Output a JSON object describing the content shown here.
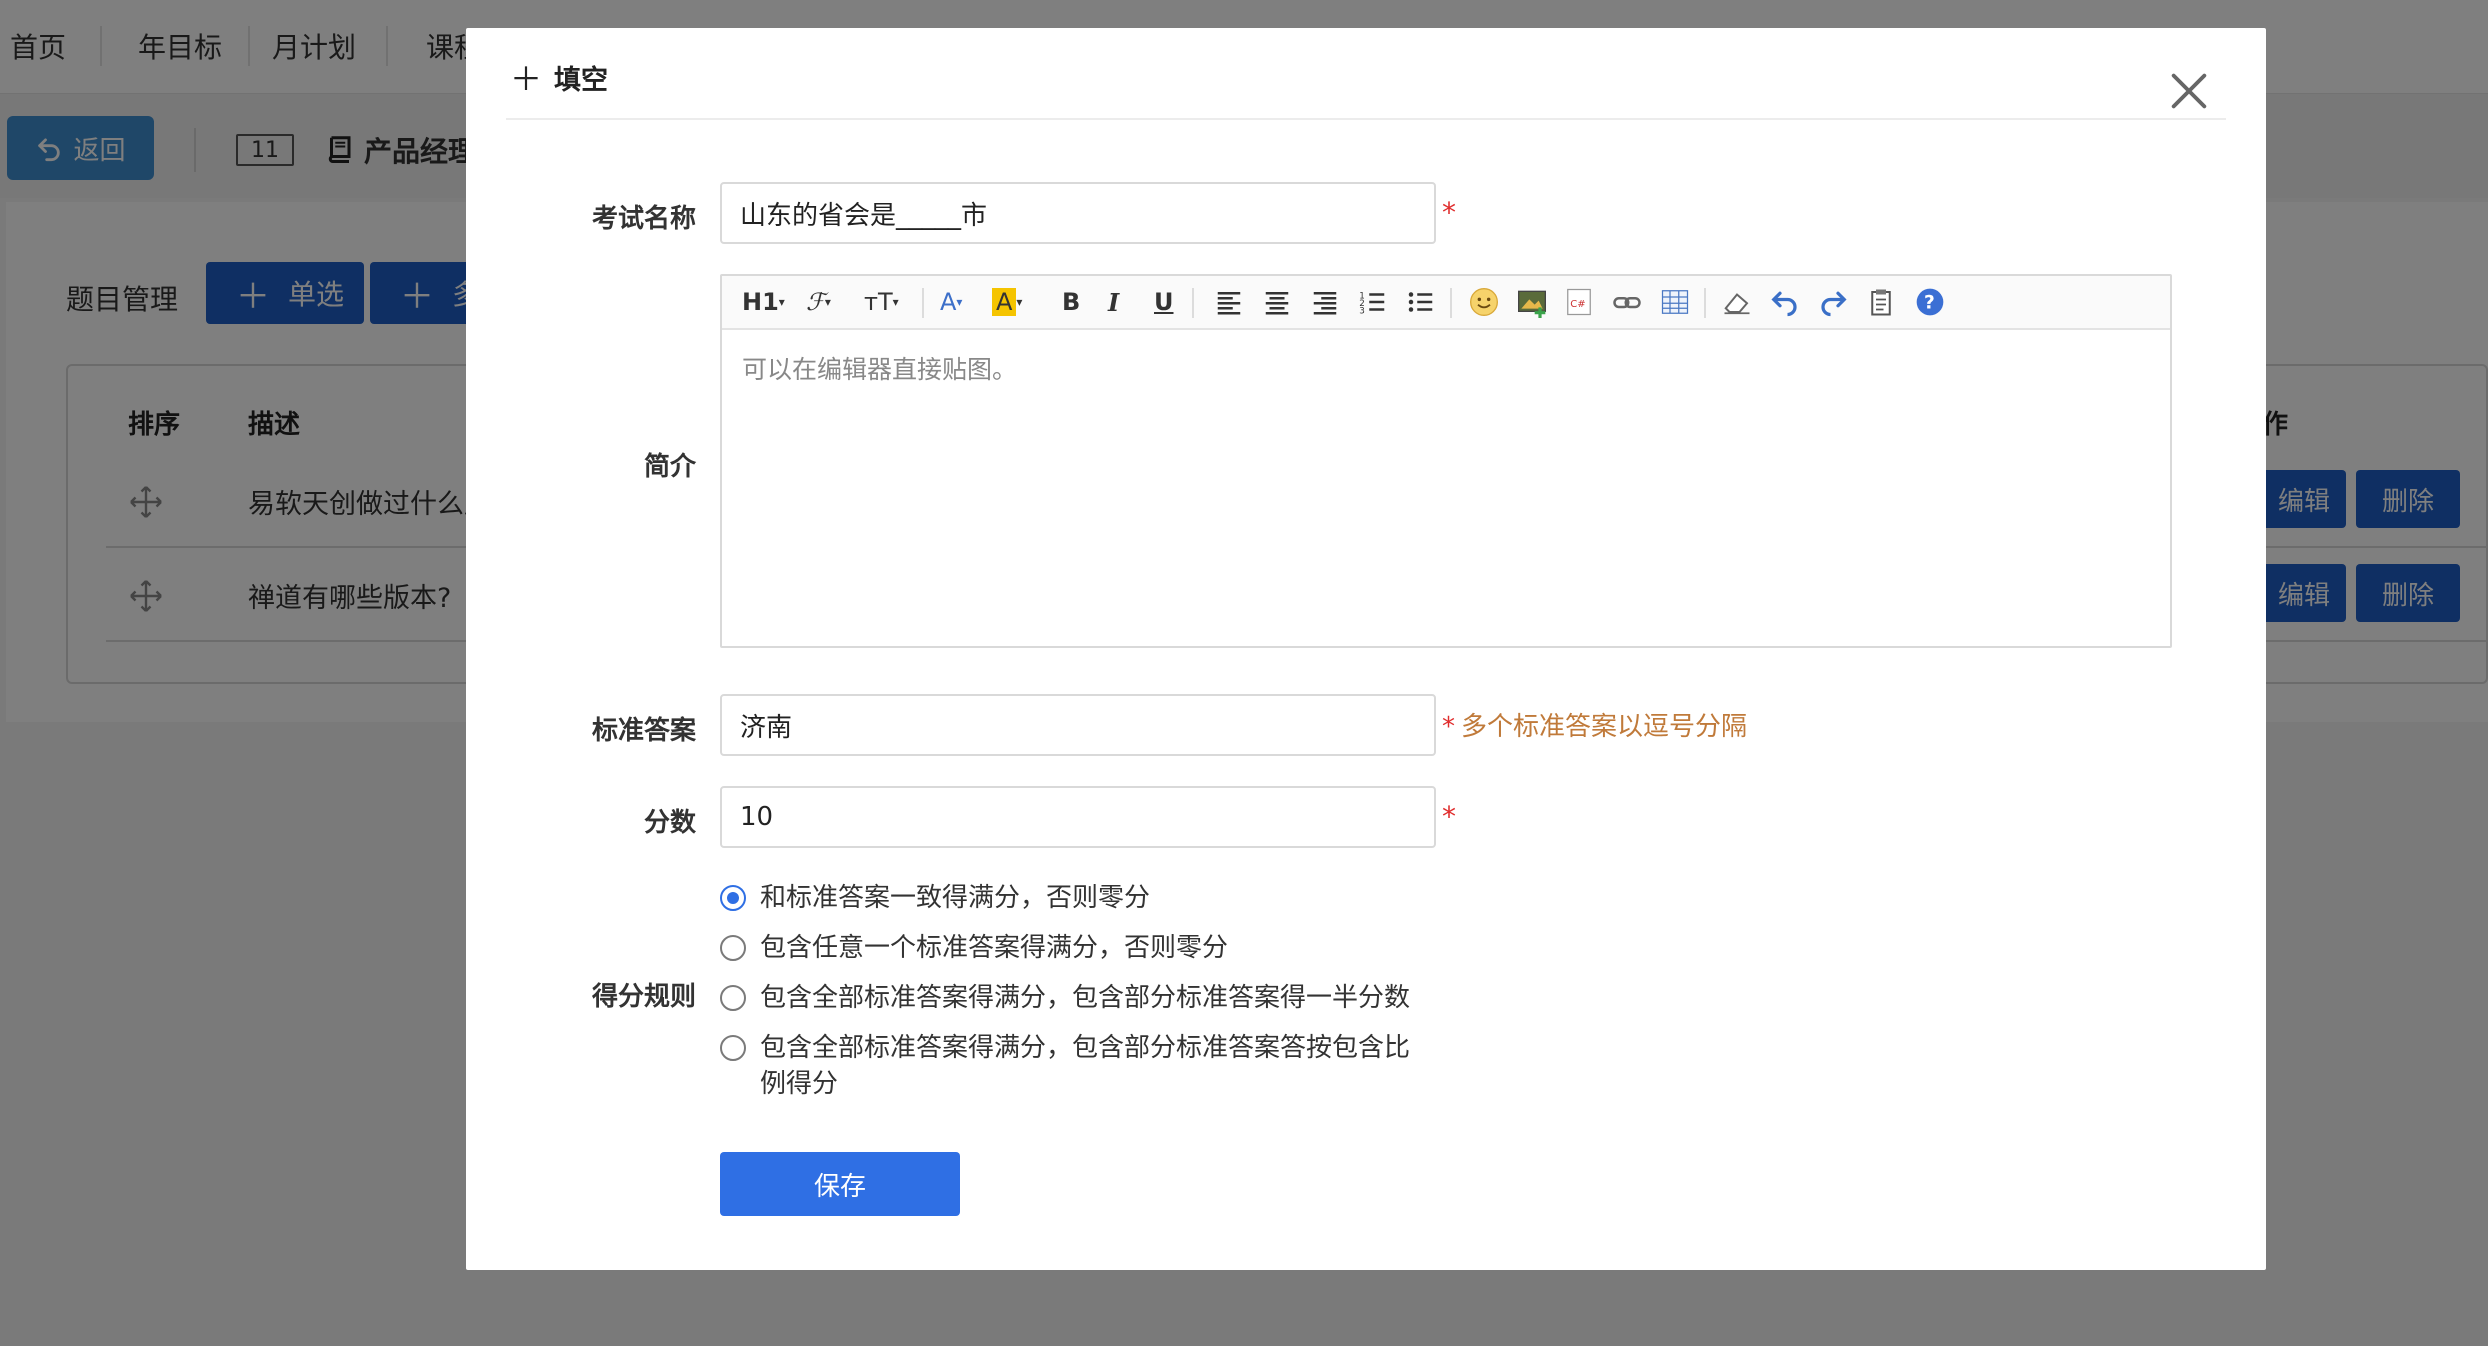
{
  "topnav": {
    "items": [
      "首页",
      "年目标",
      "月计划",
      "课程"
    ]
  },
  "subbar": {
    "back_label": "返回",
    "number": "11",
    "product_title": "产品经理"
  },
  "question_manage": {
    "label": "题目管理",
    "add_single": "单选",
    "add_multi": "多"
  },
  "table": {
    "headers": {
      "order": "排序",
      "desc": "描述",
      "action": "作"
    },
    "rows": [
      {
        "desc": "易软天创做过什么产",
        "edit": "编辑",
        "delete": "删除"
      },
      {
        "desc": "禅道有哪些版本?",
        "edit": "编辑",
        "delete": "删除"
      }
    ]
  },
  "modal": {
    "title": "填空",
    "exam_name_label": "考试名称",
    "exam_name_value": "山东的省会是_____市",
    "required_mark": "*",
    "intro_label": "简介",
    "editor_placeholder": "可以在编辑器直接贴图。",
    "toolbar": {
      "heading": "H1",
      "font": "ℱ",
      "fontsize": "тT",
      "fontcolor": "A",
      "highlight": "A",
      "bold": "B",
      "italic": "I",
      "underline": "U"
    },
    "answer_label": "标准答案",
    "answer_value": "济南",
    "answer_hint": "多个标准答案以逗号分隔",
    "score_label": "分数",
    "score_value": "10",
    "rule_label": "得分规则",
    "rules": [
      {
        "label": "和标准答案一致得满分，否则零分",
        "checked": true
      },
      {
        "label": "包含任意一个标准答案得满分，否则零分",
        "checked": false
      },
      {
        "label": "包含全部标准答案得满分，包含部分标准答案得一半分数",
        "checked": false
      },
      {
        "label": "包含全部标准答案得满分，包含部分标准答案答按包含比例得分",
        "checked": false
      }
    ],
    "save_label": "保存"
  },
  "colors": {
    "primary": "#2f6fe4",
    "dark_button": "#1f5fc6",
    "back_button": "#3e8ed0",
    "required": "#e02d2d",
    "hint": "#c07a3a"
  }
}
